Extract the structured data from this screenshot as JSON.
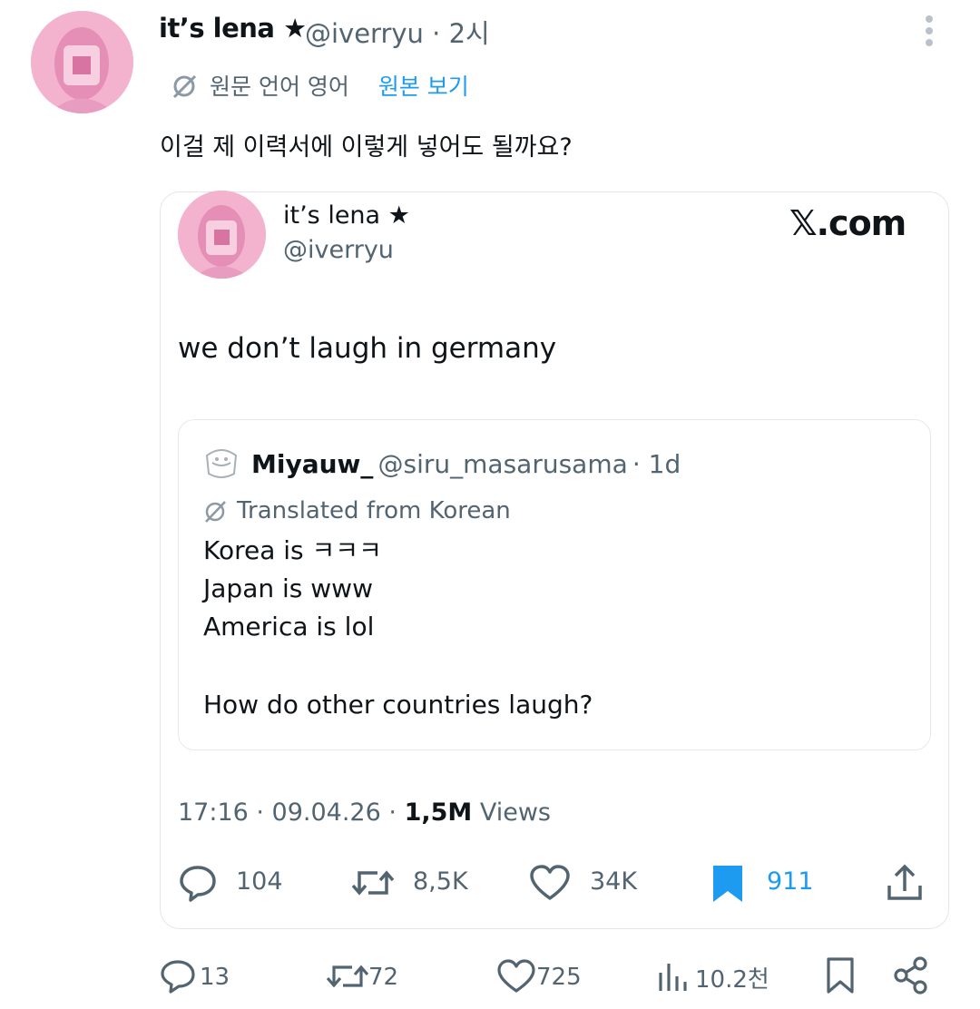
{
  "outer_tweet": {
    "display_name": "it’s lena ★",
    "handle": "@iverryu",
    "separator": "·",
    "time": "2시",
    "translation_note": "원문 언어 영어",
    "show_original": "원본 보기",
    "text": "이걸 제 이력서에 이렇게 넣어도 될까요?"
  },
  "screenshot_card": {
    "display_name": "it’s lena ★",
    "handle": "@iverryu",
    "brand": "𝕏.com",
    "text": "we don’t laugh in germany",
    "quoted_tweet": {
      "display_name": "Miyauw_",
      "handle": "@siru_masarusama",
      "time": "· 1d",
      "translation_note": "Translated from Korean",
      "lines": [
        "Korea is ㅋㅋㅋ",
        "Japan is www",
        "America is lol",
        "How do other countries laugh?"
      ]
    },
    "timestamp": "17:16 · 09.04.26 ·",
    "views_count": "1,5M",
    "views_label": "Views",
    "stats": {
      "replies": "104",
      "retweets": "8,5K",
      "likes": "34K",
      "bookmarks": "911"
    },
    "accent_color": "#1d9bf0"
  },
  "action_bar": {
    "replies": "13",
    "reposts": "72",
    "likes": "725",
    "views": "10.2천"
  }
}
